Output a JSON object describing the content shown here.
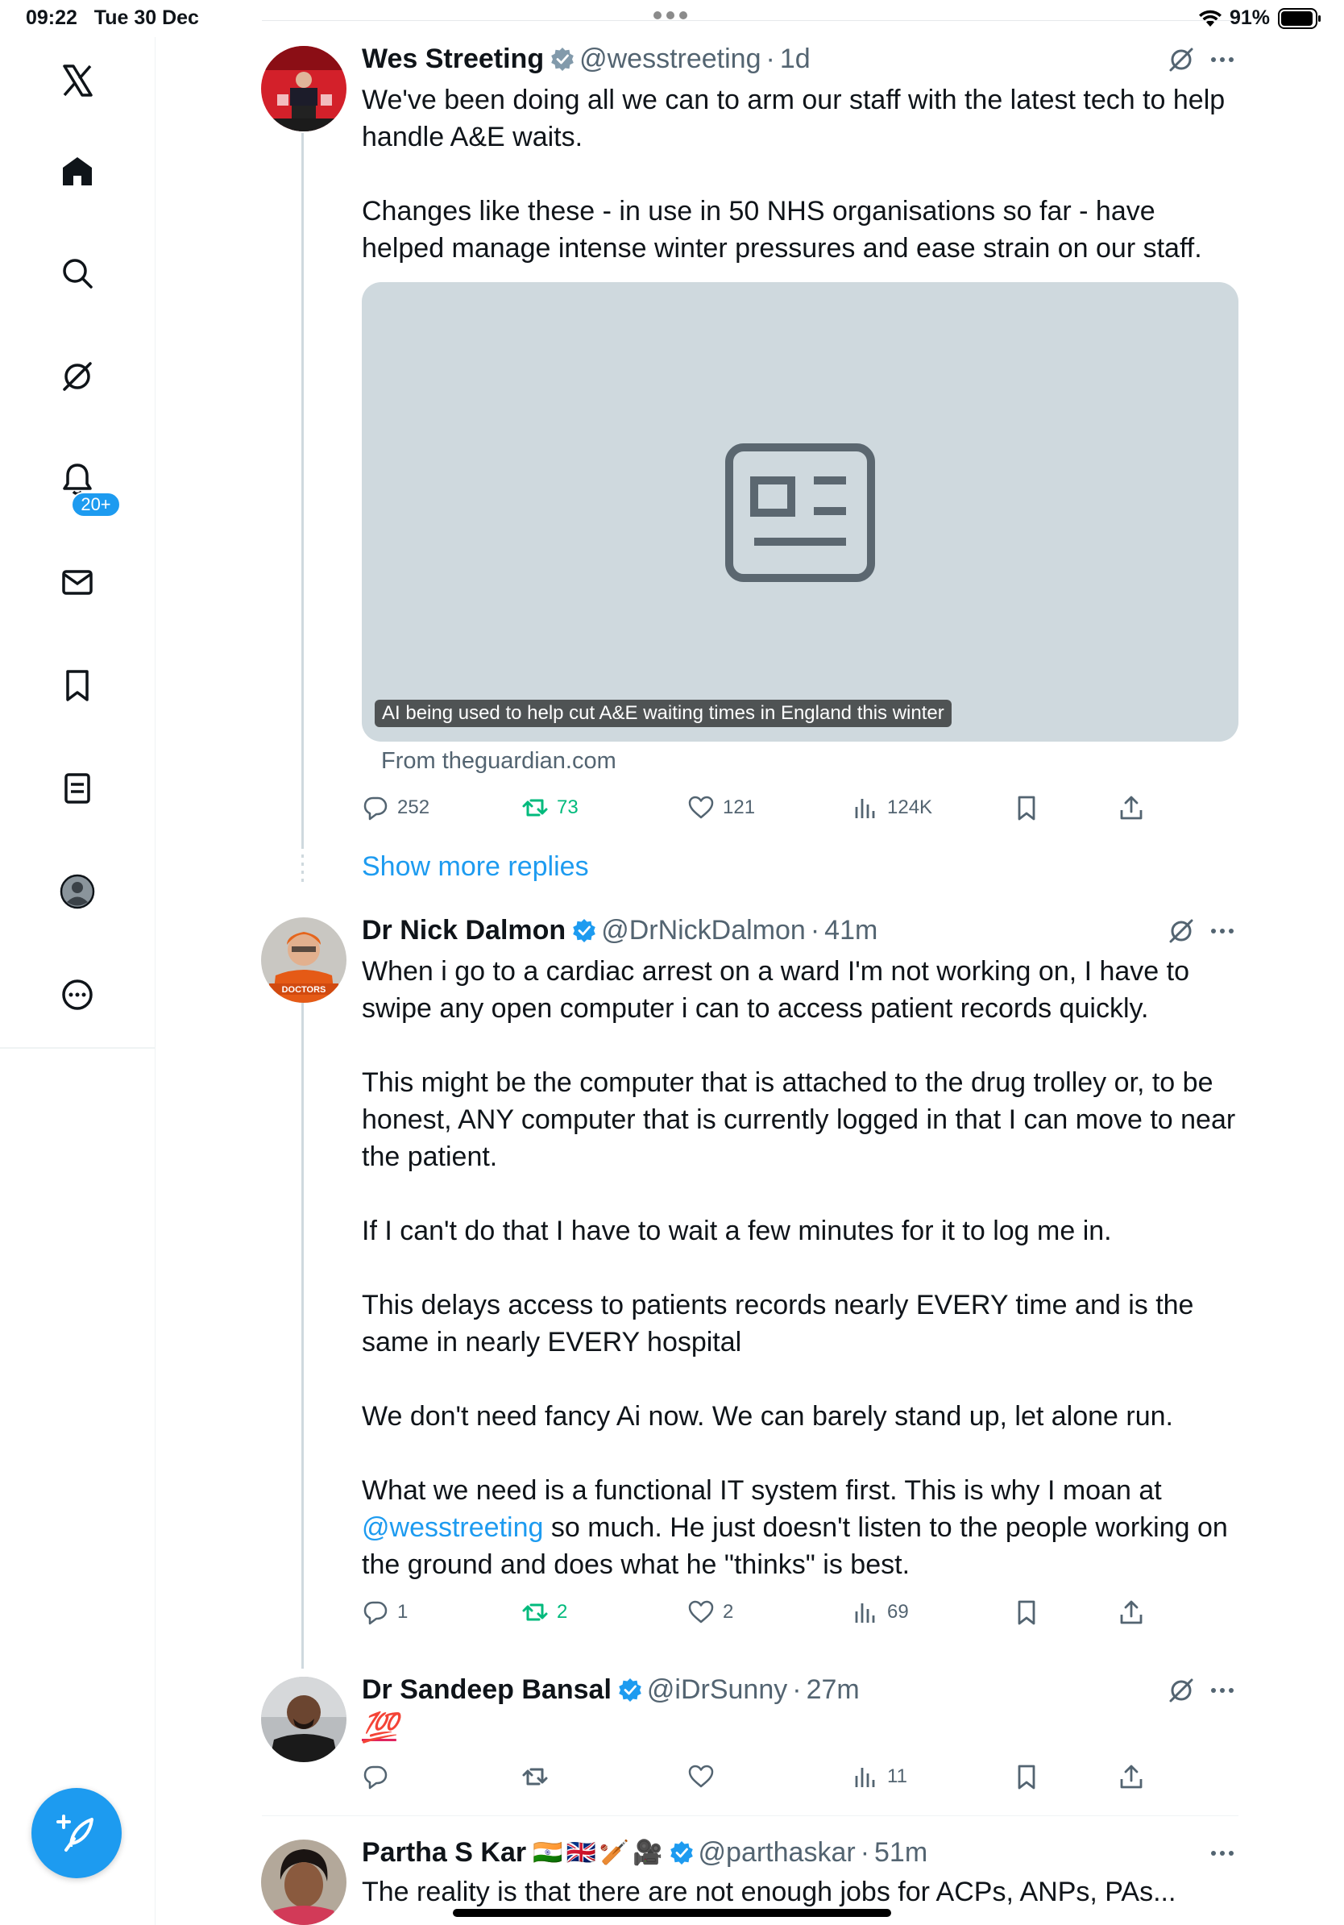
{
  "status_bar": {
    "time": "09:22",
    "date": "Tue 30 Dec",
    "battery": "91%"
  },
  "sidebar": {
    "items": [
      {
        "name": "x-logo"
      },
      {
        "name": "home"
      },
      {
        "name": "search"
      },
      {
        "name": "grok"
      },
      {
        "name": "notifications",
        "badge": "20+"
      },
      {
        "name": "messages"
      },
      {
        "name": "bookmarks"
      },
      {
        "name": "lists"
      },
      {
        "name": "profile"
      },
      {
        "name": "more"
      }
    ],
    "compose_icon": "compose-feather-icon"
  },
  "colors": {
    "accent": "#1d9bf0",
    "text": "#0f1419",
    "muted": "#536471",
    "retweet_green": "#00ba7c",
    "thread_line": "#cfd9de",
    "card_bg": "#cfd9de"
  },
  "tweets": [
    {
      "name": "Wes Streeting",
      "handle": "@wesstreeting",
      "sep": "·",
      "time": "1d",
      "verified": true,
      "text": [
        "We've been doing all we can to arm our staff with the latest tech to help handle A&E waits.",
        "Changes like these - in use in 50 NHS organisations so far - have helped manage intense winter pressures and ease strain on our staff."
      ],
      "card": {
        "title": "AI being used to help cut A&E waiting times in England this winter",
        "source": "From theguardian.com",
        "icon": "article-icon"
      },
      "stats": {
        "replies": "252",
        "reposts": "73",
        "likes": "121",
        "views": "124K"
      }
    },
    {
      "name": "Dr Nick Dalmon",
      "handle": "@DrNickDalmon",
      "sep": "·",
      "time": "41m",
      "verified": true,
      "text": [
        "When i go to a cardiac arrest on a ward I'm not working on, I have to swipe any open computer i can to access patient records quickly.",
        "This might be the computer that is attached to the drug trolley or, to be honest, ANY computer that is currently logged in that I can move to near the patient.",
        "If I can't do that I have to wait a few minutes for it to log me in.",
        "This delays access to patients records nearly EVERY time and is the same in nearly EVERY hospital",
        "We don't need fancy Ai now. We can barely stand up, let alone run.",
        "What we need is a functional IT system first. This is why I moan at"
      ],
      "text_mention": "@wesstreeting",
      "text_tail": " so much. He just doesn't listen to the people working on the ground and does what he \"thinks\" is best.",
      "stats": {
        "replies": "1",
        "reposts": "2",
        "likes": "2",
        "views": "69"
      }
    },
    {
      "name": "Dr Sandeep Bansal",
      "handle": "@iDrSunny",
      "sep": "·",
      "time": "27m",
      "verified": true,
      "text": [
        "💯"
      ],
      "stats": {
        "views": "11"
      }
    },
    {
      "name": "Partha S Kar",
      "name_emojis": [
        "🇮🇳",
        "🇬🇧",
        "🏏",
        "🎥"
      ],
      "handle": "@parthaskar",
      "sep": "·",
      "time": "51m",
      "verified": true,
      "text": [
        "The reality is that there are not enough jobs for ACPs, ANPs, PAs..."
      ]
    }
  ],
  "show_more_replies": "Show more replies"
}
